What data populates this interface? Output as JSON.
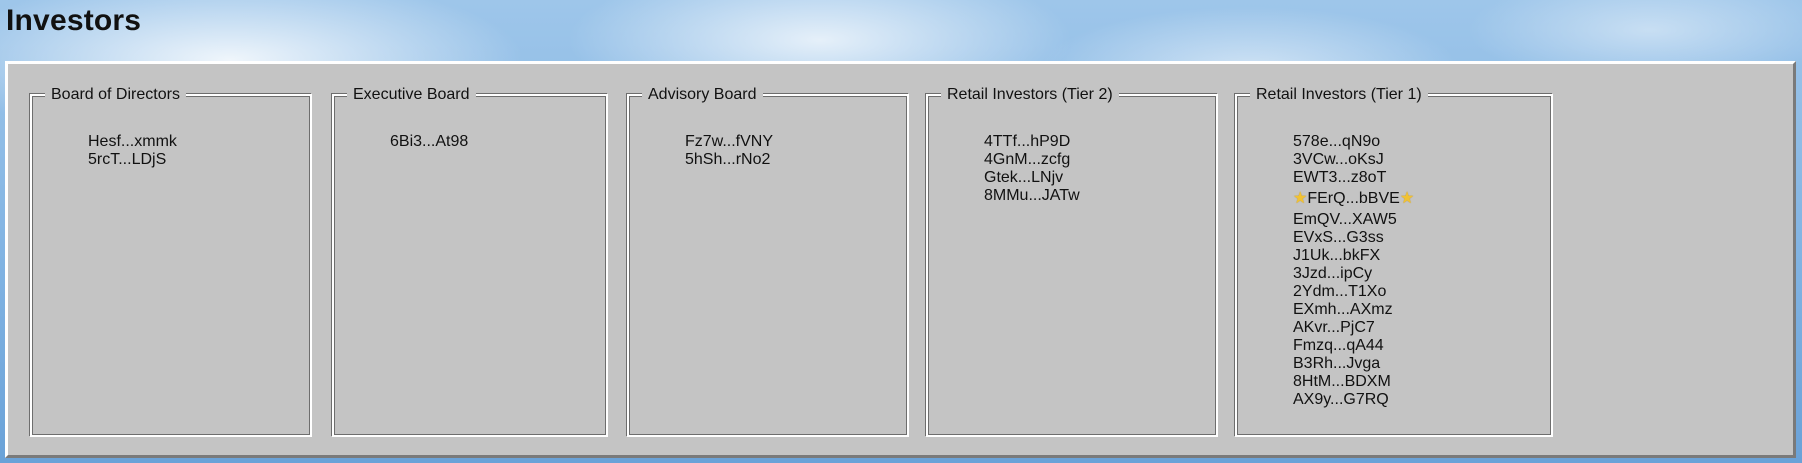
{
  "page": {
    "title": "Investors"
  },
  "groups": [
    {
      "title": "Board of Directors",
      "members": [
        {
          "label": "Hesf...xmmk"
        },
        {
          "label": "5rcT...LDjS"
        }
      ]
    },
    {
      "title": "Executive Board",
      "members": [
        {
          "label": "6Bi3...At98"
        }
      ]
    },
    {
      "title": "Advisory Board",
      "members": [
        {
          "label": "Fz7w...fVNY"
        },
        {
          "label": "5hSh...rNo2"
        }
      ]
    },
    {
      "title": "Retail Investors (Tier 2)",
      "members": [
        {
          "label": "4TTf...hP9D"
        },
        {
          "label": "4GnM...zcfg"
        },
        {
          "label": "Gtek...LNjv"
        },
        {
          "label": "8MMu...JATw"
        }
      ]
    },
    {
      "title": "Retail Investors (Tier 1)",
      "members": [
        {
          "label": "578e...qN9o"
        },
        {
          "label": "3VCw...oKsJ"
        },
        {
          "label": "EWT3...z8oT"
        },
        {
          "label": "FErQ...bBVE",
          "featured": true,
          "icon": "star-icon"
        },
        {
          "label": "EmQV...XAW5"
        },
        {
          "label": "EVxS...G3ss"
        },
        {
          "label": "J1Uk...bkFX"
        },
        {
          "label": "3Jzd...ipCy"
        },
        {
          "label": "2Ydm...T1Xo"
        },
        {
          "label": "EXmh...AXmz"
        },
        {
          "label": "AKvr...PjC7"
        },
        {
          "label": "Fmzq...qA44"
        },
        {
          "label": "B3Rh...Jvga"
        },
        {
          "label": "8HtM...BDXM"
        },
        {
          "label": "AX9y...G7RQ"
        }
      ]
    }
  ]
}
